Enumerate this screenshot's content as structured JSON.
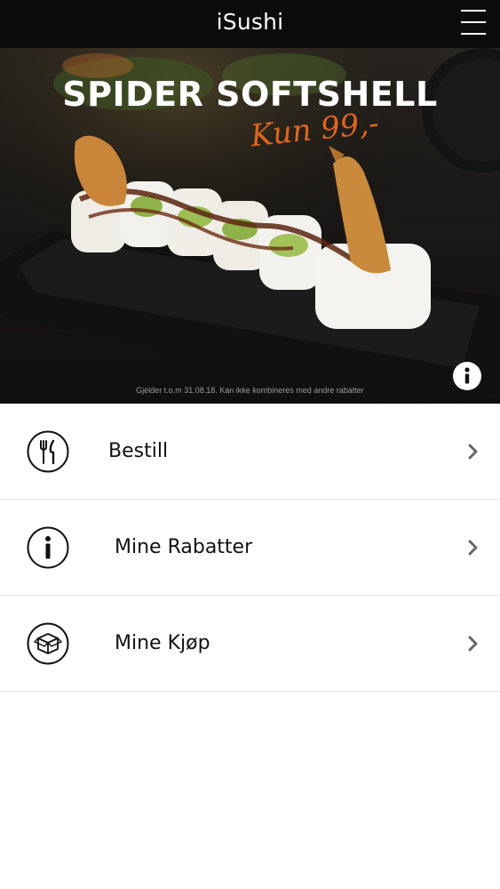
{
  "app": {
    "title": "iSushi"
  },
  "header": {
    "menu_icon": "hamburger-menu-icon"
  },
  "banner": {
    "title": "SPIDER SOFTSHELL",
    "price": "Kun 99,-",
    "disclaimer": "Gjelder t.o.m 31.08.18. Kan ikke kombineres med andre rabatter",
    "info_icon": "info-icon",
    "accent_color": "#e0651e"
  },
  "menu": [
    {
      "label": "Bestill",
      "icon": "fork-knife-icon"
    },
    {
      "label": "Mine Rabatter",
      "icon": "info-icon"
    },
    {
      "label": "Mine Kjøp",
      "icon": "box-icon"
    }
  ]
}
